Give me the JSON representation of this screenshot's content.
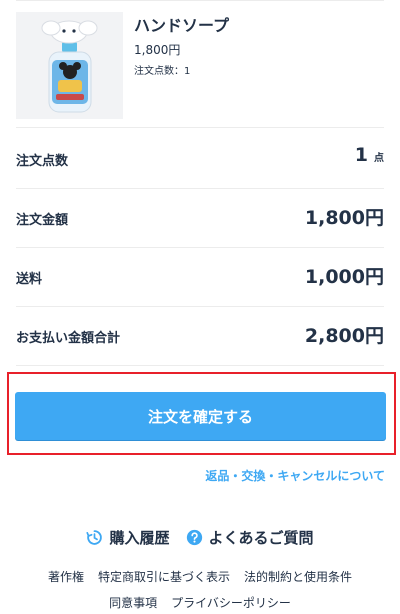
{
  "product": {
    "name": "ハンドソープ",
    "price": "1,800円",
    "quantity": "注文点数：1",
    "image_icon": "hand-soap-bottle-image"
  },
  "summary": {
    "count_label": "注文点数",
    "count_value": "1",
    "count_unit": "点",
    "amount_label": "注文金額",
    "amount_value": "1,800円",
    "shipping_label": "送料",
    "shipping_value": "1,000円",
    "total_label": "お支払い金額合計",
    "total_value": "2,800円"
  },
  "actions": {
    "confirm_label": "注文を確定する",
    "return_link": "返品・交換・キャンセルについて"
  },
  "nav": {
    "history_label": "購入履歴",
    "history_icon": "clock-history-icon",
    "faq_label": "よくあるご質問",
    "faq_icon": "question-circle-icon"
  },
  "footer": {
    "links_row1": [
      "著作権",
      "特定商取引に基づく表示",
      "法的制約と使用条件"
    ],
    "links_row2": [
      "同意事項",
      "プライバシーポリシー"
    ]
  },
  "colors": {
    "primary": "#3ea8f3",
    "text": "#233247",
    "highlight_border": "#e8202a",
    "divider": "#ececec"
  }
}
